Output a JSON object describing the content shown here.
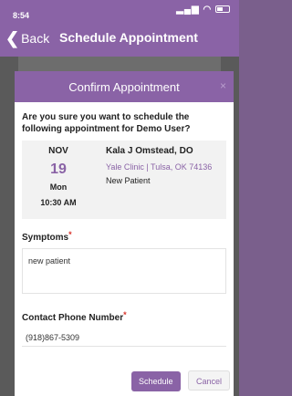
{
  "status": {
    "time": "8:54",
    "location_arrow": "◂",
    "signal": "..ıl"
  },
  "nav": {
    "back_label": "Back",
    "title": "Schedule Appointment"
  },
  "modal": {
    "title": "Confirm Appointment",
    "close": "×",
    "question": "Are you sure you want to schedule the following appointment for Demo User?",
    "appointment": {
      "month": "NOV",
      "day": "19",
      "weekday": "Mon",
      "time": "10:30 AM",
      "doctor": "Kala J Omstead, DO",
      "clinic": "Yale Clinic | Tulsa, OK 74136",
      "patient_type": "New Patient"
    },
    "symptoms": {
      "label": "Symptoms",
      "required": "*",
      "value": "new patient"
    },
    "phone": {
      "label": "Contact Phone Number",
      "required": "*",
      "value": "(918)867-5309"
    },
    "buttons": {
      "schedule": "Schedule",
      "cancel": "Cancel"
    }
  },
  "colors": {
    "accent": "#8a63a6",
    "required": "#d9342b"
  }
}
